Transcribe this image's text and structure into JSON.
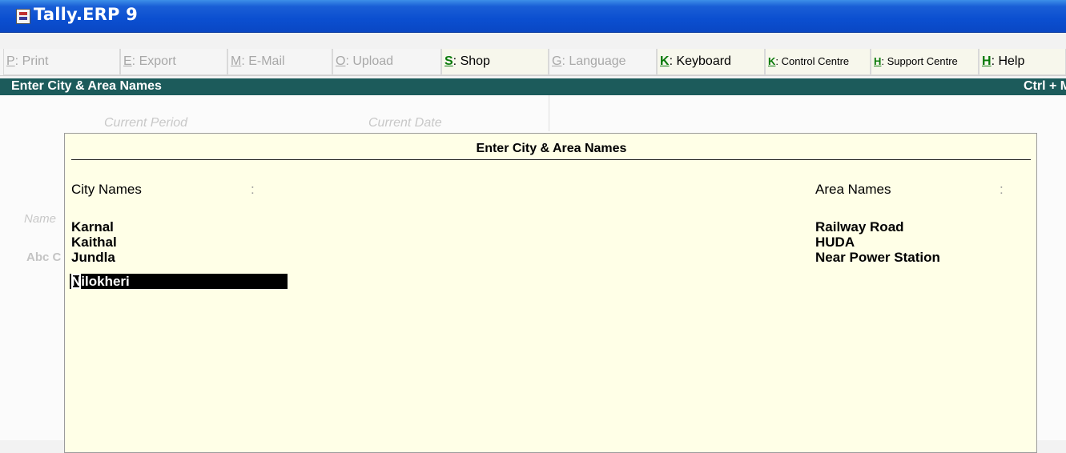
{
  "window": {
    "title": "Tally.ERP 9",
    "icon": "tally-app-icon"
  },
  "buttonbar": {
    "items": [
      {
        "key": "P",
        "label": ": Print",
        "enabled": false
      },
      {
        "key": "E",
        "label": ": Export",
        "enabled": false
      },
      {
        "key": "M",
        "label": ": E-Mail",
        "enabled": false
      },
      {
        "key": "O",
        "label": ": Upload",
        "enabled": false
      },
      {
        "key": "S",
        "label": ": Shop",
        "enabled": true
      },
      {
        "key": "G",
        "label": ": Language",
        "enabled": false
      },
      {
        "key": "K",
        "label": ": Keyboard",
        "enabled": true
      },
      {
        "key": "K",
        "label": ": Control Centre",
        "enabled": true
      },
      {
        "key": "H",
        "label": ": Support Centre",
        "enabled": true
      },
      {
        "key": "H",
        "label": ": Help",
        "enabled": true
      }
    ]
  },
  "screen": {
    "title": "Enter City & Area Names",
    "hint": "Ctrl + M"
  },
  "background": {
    "current_period": "Current Period",
    "current_date": "Current Date",
    "name_label": "Name",
    "company_partial": "Abc C"
  },
  "dialog": {
    "title": "Enter City & Area Names",
    "city_label": "City Names",
    "area_label": "Area Names",
    "colon": ":",
    "cities": [
      "Karnal",
      "Kaithal",
      "Jundla",
      "Nilokheri"
    ],
    "selected_city_index": 3,
    "areas": [
      "Railway Road",
      "HUDA",
      "Near Power Station"
    ]
  },
  "colors": {
    "titlebar": "#0b4fd0",
    "screenbar": "#1c5b5b",
    "dialog_bg": "#ffffe7",
    "hotkey_green": "#0a7a0a"
  }
}
